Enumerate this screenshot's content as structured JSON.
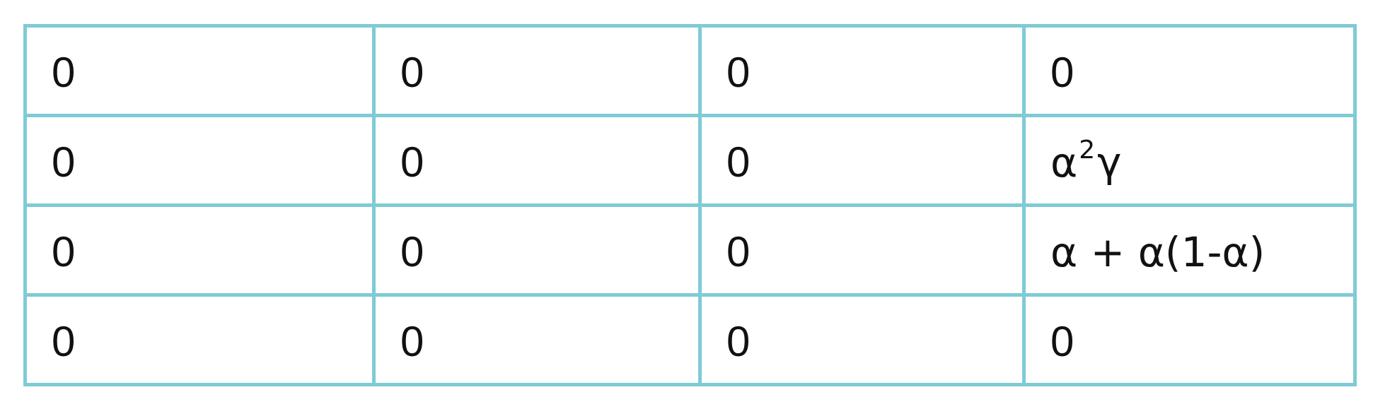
{
  "table": {
    "rows": [
      {
        "cells": [
          "0",
          "0",
          "0",
          "0"
        ]
      },
      {
        "cells": [
          "0",
          "0",
          "0"
        ],
        "expr": {
          "base": "α",
          "exp": "2",
          "rest": "γ"
        }
      },
      {
        "cells": [
          "0",
          "0",
          "0",
          "α + α(1-α)"
        ]
      },
      {
        "cells": [
          "0",
          "0",
          "0",
          "0"
        ]
      }
    ]
  },
  "colors": {
    "border": "#7ecbd6",
    "text": "#111111",
    "background": "#ffffff"
  }
}
